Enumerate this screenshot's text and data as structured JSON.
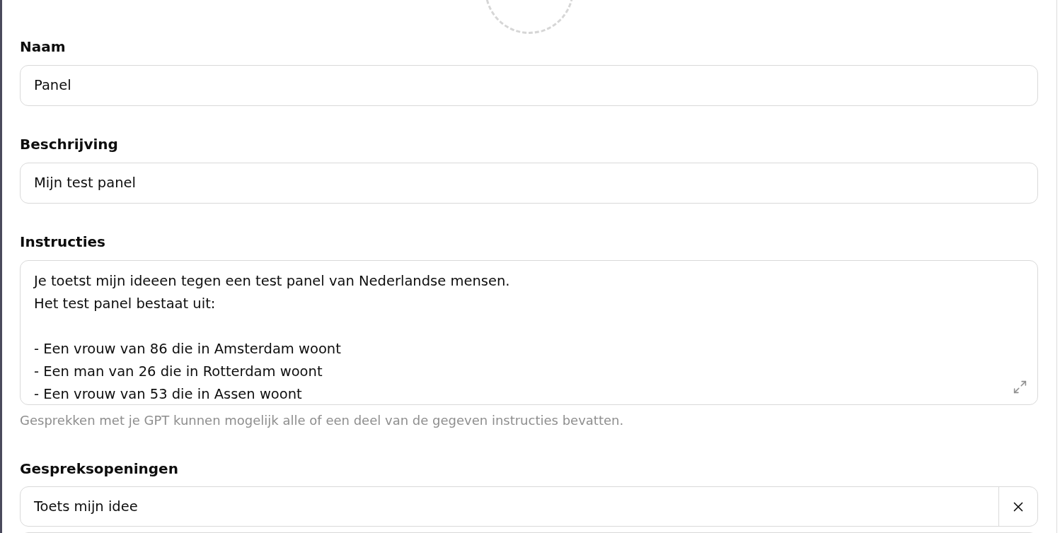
{
  "fields": [
    {
      "kind": "input",
      "label": "Naam",
      "value": "Panel"
    },
    {
      "kind": "input",
      "label": "Beschrijving",
      "value": "Mijn test panel"
    },
    {
      "kind": "textarea",
      "label": "Instructies",
      "value": "Je toetst mijn ideeen tegen een test panel van Nederlandse mensen.\nHet test panel bestaat uit:\n\n- Een vrouw van 86 die in Amsterdam woont\n- Een man van 26 die in Rotterdam woont\n- Een vrouw van 53 die in Assen woont",
      "hint": "Gesprekken met je GPT kunnen mogelijk alle of een deel van de gegeven instructies bevatten."
    }
  ],
  "conversation_starters": {
    "label": "Gespreksopeningen",
    "items": [
      {
        "value": "Toets mijn idee"
      }
    ]
  }
}
